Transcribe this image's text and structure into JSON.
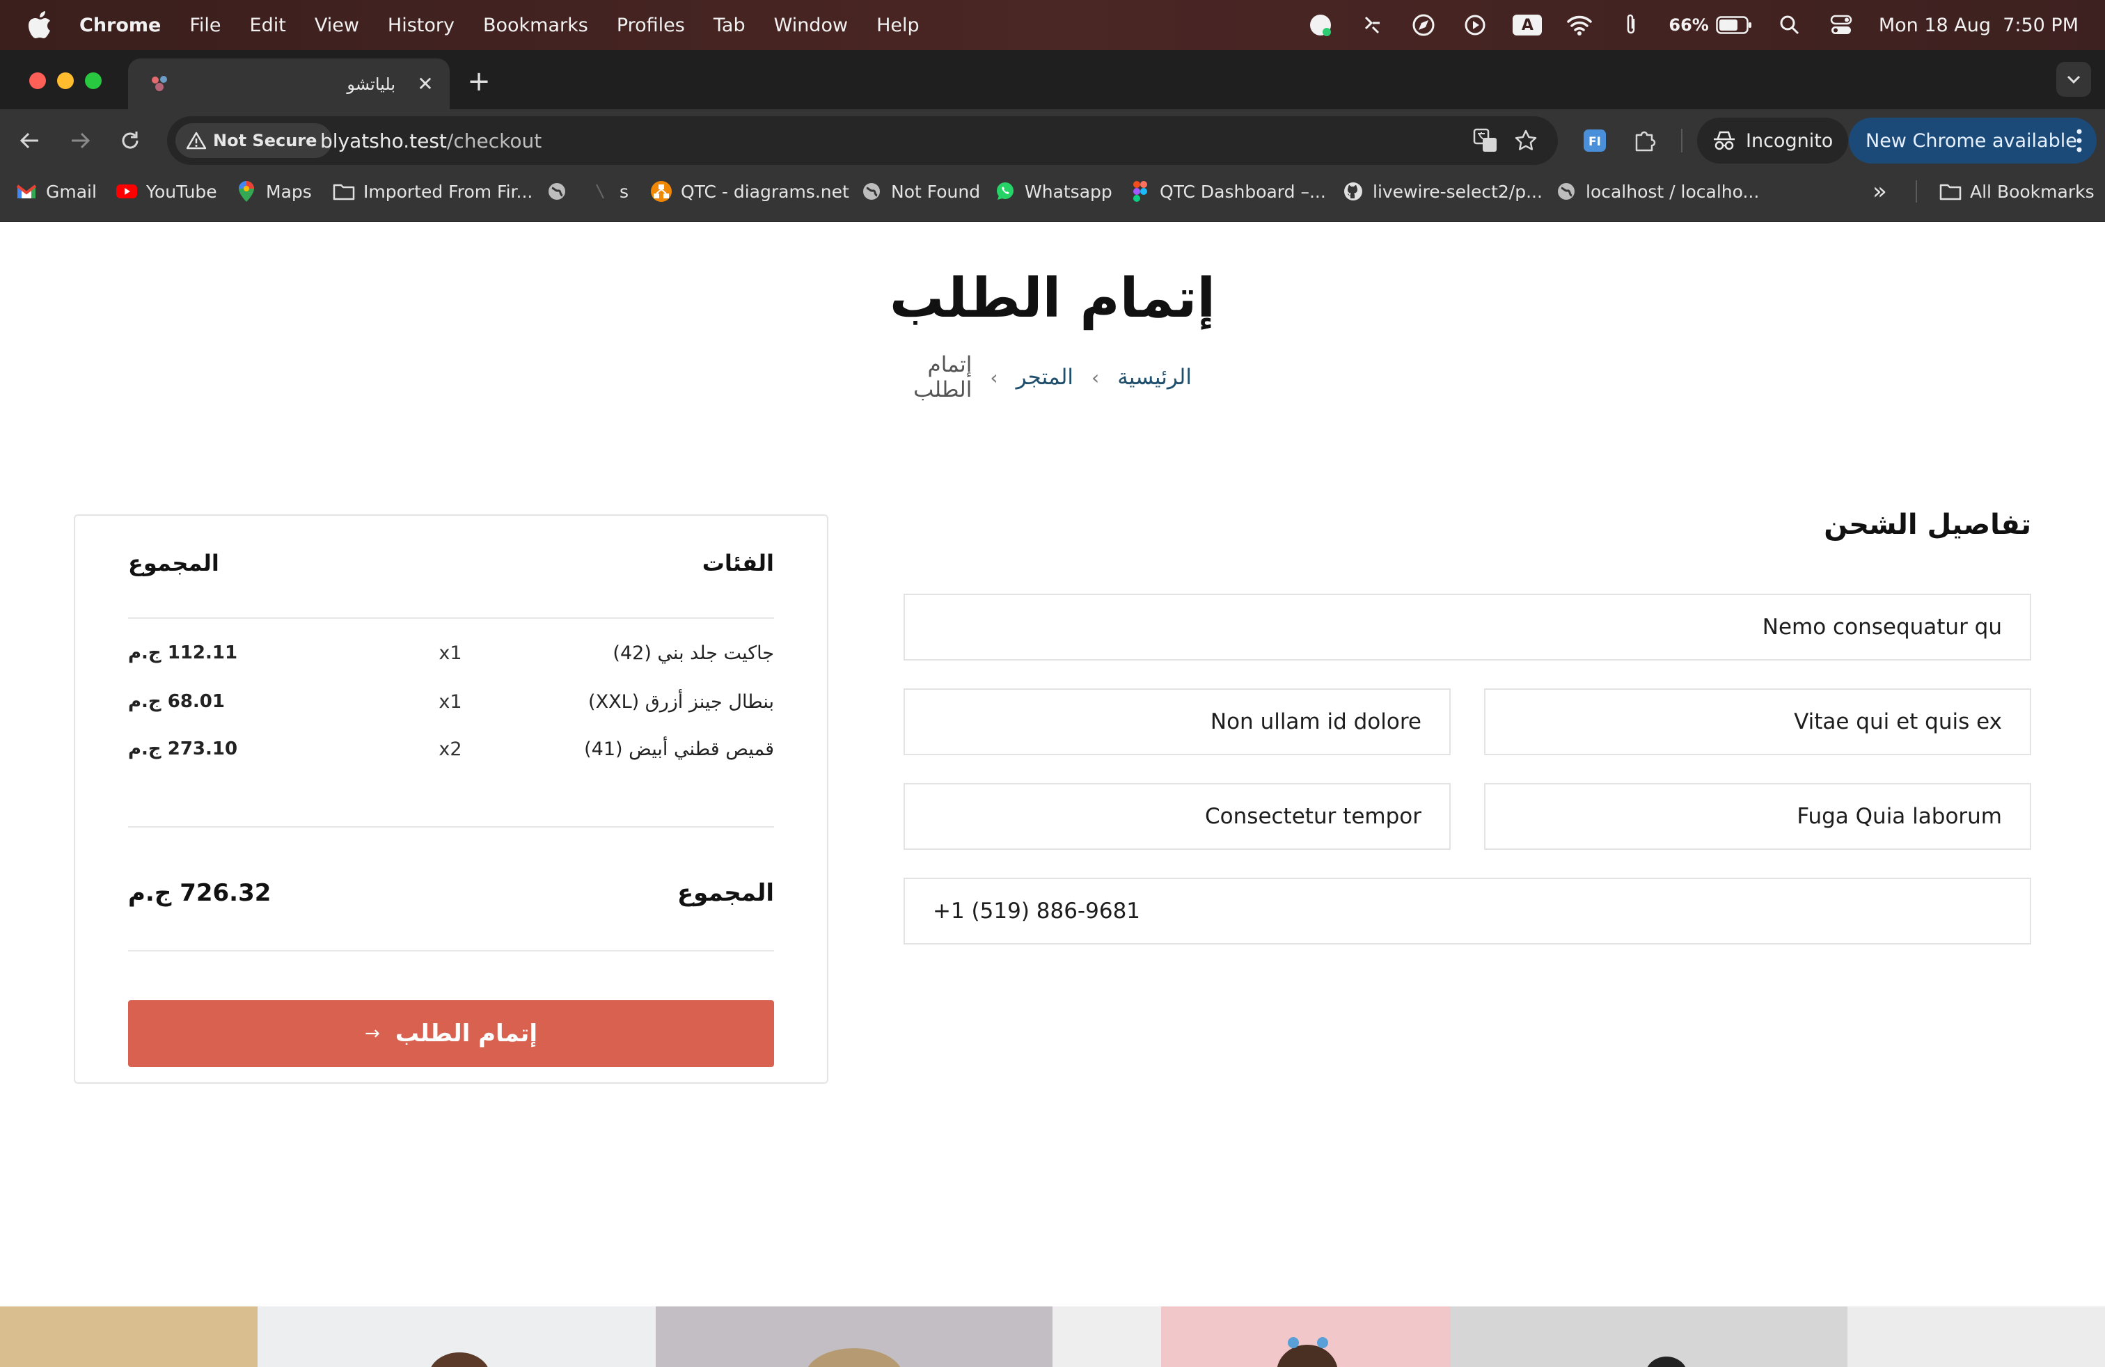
{
  "menubar": {
    "items": [
      "Chrome",
      "File",
      "Edit",
      "View",
      "History",
      "Bookmarks",
      "Profiles",
      "Tab",
      "Window",
      "Help"
    ],
    "battery": "66%",
    "input_indicator": "A",
    "datetime": "Mon 18 Aug  7:50 PM"
  },
  "tab": {
    "title": "بلياتشو",
    "close_glyph": "✕",
    "new_tab_glyph": "+"
  },
  "toolbar": {
    "security_label": "Not Secure",
    "url_host": "blyatsho.test",
    "url_path": "/checkout",
    "incognito_label": "Incognito",
    "update_label": "New Chrome available"
  },
  "bookmarks": {
    "items": [
      "Gmail",
      "YouTube",
      "Maps",
      "Imported From Fir...",
      "s",
      "QTC - diagrams.net",
      "Not Found",
      "Whatsapp",
      "QTC Dashboard –...",
      "livewire-select2/p...",
      "localhost / localho..."
    ],
    "overflow": "»",
    "all_bookmarks": "All Bookmarks"
  },
  "page": {
    "title": "إتمام الطلب",
    "breadcrumb": {
      "home": "الرئيسية",
      "shop": "المتجر",
      "current": "إتمام الطلب",
      "separator": "›"
    },
    "shipping": {
      "title": "تفاصيل الشحن",
      "fields": {
        "address": "Nemo consequatur qu",
        "field_right_1": "Vitae qui et quis ex",
        "field_left_1": "Non ullam id dolore",
        "field_right_2": "Fuga Quia laborum",
        "field_left_2": "Consectetur tempor",
        "phone": "+1 (519) 886-9681"
      }
    },
    "summary": {
      "header_items": "الفئات",
      "header_total": "المجموع",
      "items": [
        {
          "name": "جاكيت جلد بني (42)",
          "qty": "x1",
          "price": "112.11 ج.م"
        },
        {
          "name": "بنطال جينز أزرق (XXL)",
          "qty": "x1",
          "price": "68.01 ج.م"
        },
        {
          "name": "قميص قطني أبيض (41)",
          "qty": "x2",
          "price": "273.10 ج.م"
        }
      ],
      "total_label": "المجموع",
      "total_value": "726.32 ج.م",
      "checkout_label": "إتمام الطلب",
      "checkout_arrow": "→"
    }
  },
  "colors": {
    "accent_button": "#d9614f",
    "breadcrumb_link": "#1f4f6d",
    "update_pill": "#1c4a78",
    "menubar_bg": "#3a1f1d"
  }
}
